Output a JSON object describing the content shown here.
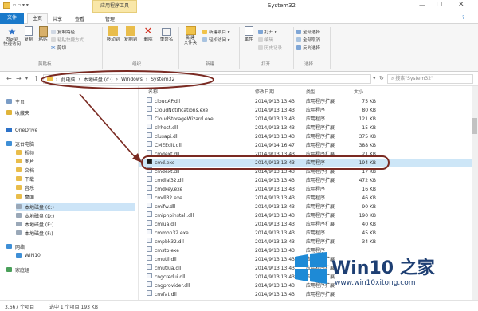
{
  "title_bar": {
    "title": "System32",
    "contextual_tab": "应用程序工具",
    "qat": "▾"
  },
  "tabs": [
    {
      "label": "文件"
    },
    {
      "label": "主页"
    },
    {
      "label": "共享"
    },
    {
      "label": "查看"
    },
    {
      "label": "管理"
    }
  ],
  "ribbon": {
    "pin": "固定到\n快速访问",
    "copy": "复制",
    "paste": "粘贴",
    "copy_path": "复制路径",
    "paste_shortcut": "粘贴快捷方式",
    "cut": "剪切",
    "move_to": "移动到",
    "copy_to": "复制到",
    "delete": "删除",
    "rename": "重命名",
    "new_folder": "新建\n文件夹",
    "new_item": "新建项目 ▾",
    "easy_access": "轻松访问 ▾",
    "properties": "属性",
    "open": "打开 ▾",
    "edit": "编辑",
    "history": "历史记录",
    "select_all": "全部选择",
    "select_none": "全部取消",
    "invert": "反向选择",
    "groups": {
      "clipboard": "剪贴板",
      "organize": "组织",
      "new": "新建",
      "open": "打开",
      "select": "选择"
    }
  },
  "breadcrumb": {
    "parts": [
      "此电脑",
      "本地磁盘 (C:)",
      "Windows",
      "System32"
    ]
  },
  "search": {
    "placeholder": "搜索\"System32\""
  },
  "sidebar": [
    {
      "label": "主页",
      "icon": "home-icon"
    },
    {
      "label": "收藏夹",
      "icon": "star-icon"
    },
    {
      "label": "OneDrive",
      "icon": "cloud-icon"
    },
    {
      "label": "这台电脑",
      "icon": "computer-icon"
    },
    {
      "label": "视频",
      "icon": "folder-icon"
    },
    {
      "label": "图片",
      "icon": "folder-icon"
    },
    {
      "label": "文档",
      "icon": "folder-icon"
    },
    {
      "label": "下载",
      "icon": "folder-icon"
    },
    {
      "label": "音乐",
      "icon": "folder-icon"
    },
    {
      "label": "桌面",
      "icon": "folder-icon"
    },
    {
      "label": "本地磁盘 (C:)",
      "icon": "drive-icon"
    },
    {
      "label": "本地磁盘 (D:)",
      "icon": "drive-icon"
    },
    {
      "label": "本地磁盘 (E:)",
      "icon": "drive-icon"
    },
    {
      "label": "本地磁盘 (F:)",
      "icon": "drive-icon"
    },
    {
      "label": "网络",
      "icon": "network-icon"
    },
    {
      "label": "WIN10",
      "icon": "computer-icon"
    },
    {
      "label": "家庭组",
      "icon": "homegroup-icon"
    }
  ],
  "columns": {
    "name": "名称",
    "date": "修改日期",
    "type": "类型",
    "size": "大小"
  },
  "files": [
    {
      "name": "cloudAP.dll",
      "date": "2014/9/13 13:43",
      "type": "应用程序扩展",
      "size": "75 KB"
    },
    {
      "name": "CloudNotifications.exe",
      "date": "2014/9/13 13:43",
      "type": "应用程序",
      "size": "80 KB"
    },
    {
      "name": "CloudStorageWizard.exe",
      "date": "2014/9/13 13:43",
      "type": "应用程序",
      "size": "121 KB"
    },
    {
      "name": "clrhost.dll",
      "date": "2014/9/13 13:43",
      "type": "应用程序扩展",
      "size": "15 KB"
    },
    {
      "name": "clusapi.dll",
      "date": "2014/9/13 13:43",
      "type": "应用程序扩展",
      "size": "375 KB"
    },
    {
      "name": "CMEEdit.dll",
      "date": "2014/9/14 16:47",
      "type": "应用程序扩展",
      "size": "388 KB"
    },
    {
      "name": "cmdext.dll",
      "date": "2014/9/13 13:43",
      "type": "应用程序扩展",
      "size": "21 KB"
    },
    {
      "name": "cmd.exe",
      "date": "2014/9/13 13:43",
      "type": "应用程序",
      "size": "194 KB"
    },
    {
      "name": "cmdext.dll",
      "date": "2014/9/13 13:43",
      "type": "应用程序扩展",
      "size": "17 KB"
    },
    {
      "name": "cmdial32.dll",
      "date": "2014/9/13 13:43",
      "type": "应用程序扩展",
      "size": "472 KB"
    },
    {
      "name": "cmdkey.exe",
      "date": "2014/9/13 13:43",
      "type": "应用程序",
      "size": "16 KB"
    },
    {
      "name": "cmdl32.exe",
      "date": "2014/9/13 13:43",
      "type": "应用程序",
      "size": "46 KB"
    },
    {
      "name": "cmifw.dll",
      "date": "2014/9/13 13:43",
      "type": "应用程序扩展",
      "size": "90 KB"
    },
    {
      "name": "cmipnpinstall.dll",
      "date": "2014/9/13 13:43",
      "type": "应用程序扩展",
      "size": "190 KB"
    },
    {
      "name": "cmlua.dll",
      "date": "2014/9/13 13:43",
      "type": "应用程序扩展",
      "size": "40 KB"
    },
    {
      "name": "cmmon32.exe",
      "date": "2014/9/13 13:43",
      "type": "应用程序",
      "size": "45 KB"
    },
    {
      "name": "cmpbk32.dll",
      "date": "2014/9/13 13:43",
      "type": "应用程序扩展",
      "size": "34 KB"
    },
    {
      "name": "cmstp.exe",
      "date": "2014/9/13 13:43",
      "type": "应用程序",
      "size": ""
    },
    {
      "name": "cmutil.dll",
      "date": "2014/9/13 13:43",
      "type": "应用程序扩展",
      "size": ""
    },
    {
      "name": "cmutlua.dll",
      "date": "2014/9/13 13:43",
      "type": "应用程序扩展",
      "size": ""
    },
    {
      "name": "cngcredui.dll",
      "date": "2014/9/13 13:43",
      "type": "应用程序扩展",
      "size": ""
    },
    {
      "name": "cngprovider.dll",
      "date": "2014/9/13 13:43",
      "type": "应用程序扩展",
      "size": ""
    },
    {
      "name": "cnvfat.dll",
      "date": "2014/9/13 13:43",
      "type": "应用程序扩展",
      "size": ""
    }
  ],
  "highlighted_index": 7,
  "status": {
    "count": "3,667 个项目",
    "selected": "选中 1 个项目 193 KB"
  },
  "watermark": {
    "brand": "Win10 之家",
    "url": "www.win10xitong.com"
  },
  "colors": {
    "accent": "#2d72c8",
    "annotation": "#7a2a22",
    "highlight": "#cde6f7",
    "win_blue": "#1e8ad6"
  }
}
